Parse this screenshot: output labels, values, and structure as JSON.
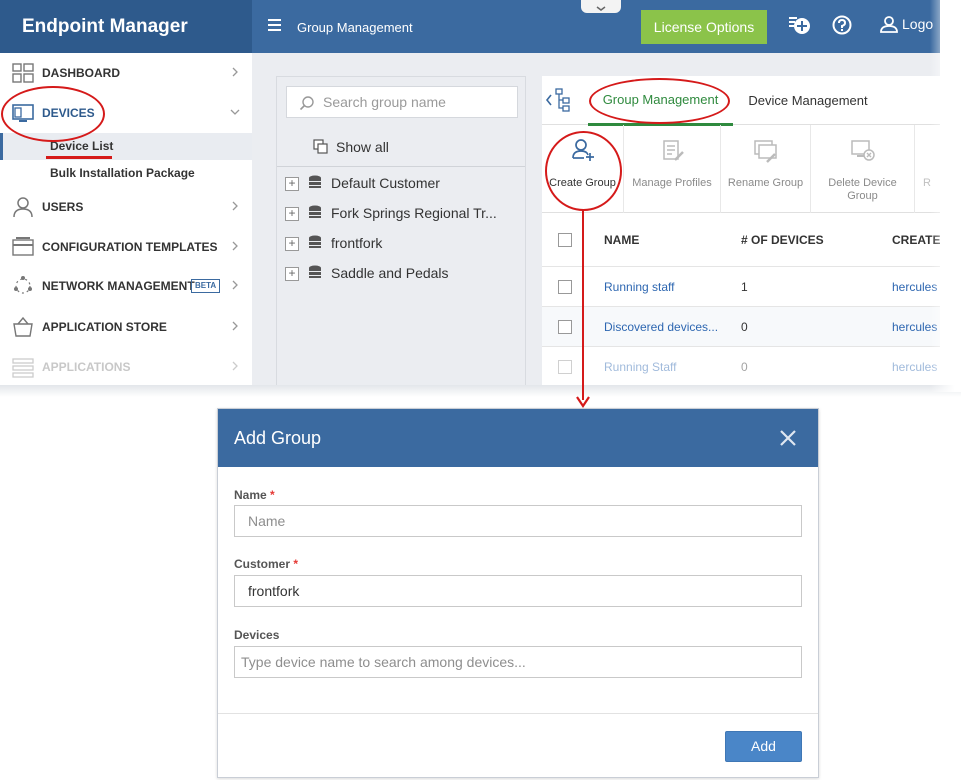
{
  "app": {
    "brand": "Endpoint Manager",
    "top_title": "Group Management",
    "license_button": "License Options",
    "logout": "Logo",
    "brand_color": "#2e5a8c",
    "header_color": "#3b6aa0",
    "license_color": "#8bc34a",
    "annotation_color": "#d51a1a"
  },
  "sidebar": {
    "items": [
      {
        "label": "DASHBOARD",
        "icon": "dashboard-grid-icon"
      },
      {
        "label": "DEVICES",
        "icon": "devices-icon"
      },
      {
        "label": "USERS",
        "icon": "user-icon"
      },
      {
        "label": "CONFIGURATION TEMPLATES",
        "icon": "templates-icon"
      },
      {
        "label": "NETWORK MANAGEMENT",
        "icon": "network-icon",
        "badge": "BETA"
      },
      {
        "label": "APPLICATION STORE",
        "icon": "store-basket-icon"
      },
      {
        "label": "APPLICATIONS",
        "icon": "applications-icon"
      }
    ],
    "sub_items": [
      {
        "label": "Device List",
        "active": true
      },
      {
        "label": "Bulk Installation Package",
        "active": false
      }
    ]
  },
  "tree": {
    "search_placeholder": "Search group name",
    "show_all": "Show all",
    "customers": [
      "Default Customer",
      "Fork Springs Regional Tr...",
      "frontfork",
      "Saddle and Pedals"
    ]
  },
  "main": {
    "tabs": [
      "Group Management",
      "Device Management"
    ],
    "toolbar": [
      "Create Group",
      "Manage Profiles",
      "Rename Group",
      "Delete Device Group",
      "R"
    ],
    "columns": [
      "NAME",
      "# OF DEVICES",
      "CREATED"
    ],
    "rows": [
      {
        "name": "Running staff",
        "devices": "1",
        "creator": "hercules"
      },
      {
        "name": "Discovered devices...",
        "devices": "0",
        "creator": "hercules"
      },
      {
        "name": "Running Staff",
        "devices": "0",
        "creator": "hercules"
      }
    ]
  },
  "modal": {
    "title": "Add Group",
    "name_label": "Name",
    "name_placeholder": "Name",
    "customer_label": "Customer",
    "customer_value": "frontfork",
    "devices_label": "Devices",
    "devices_placeholder": "Type device name to search among devices...",
    "required_mark": "*",
    "add_button": "Add"
  }
}
